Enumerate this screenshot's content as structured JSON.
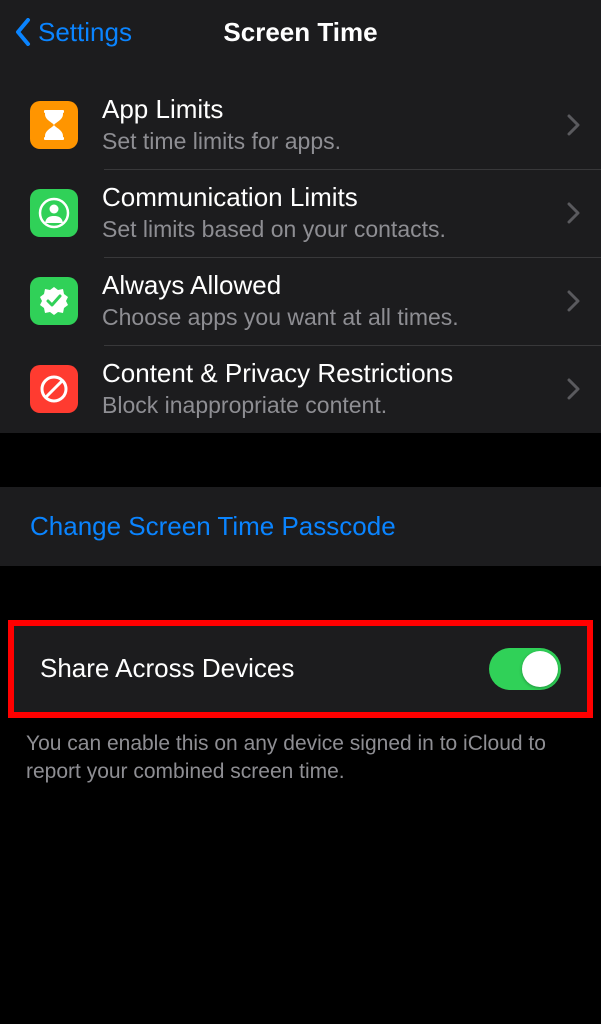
{
  "header": {
    "back_label": "Settings",
    "title": "Screen Time"
  },
  "rows": [
    {
      "title": "App Limits",
      "subtitle": "Set time limits for apps.",
      "icon_name": "hourglass-icon",
      "icon_color": "orange"
    },
    {
      "title": "Communication Limits",
      "subtitle": "Set limits based on your contacts.",
      "icon_name": "contact-circle-icon",
      "icon_color": "green"
    },
    {
      "title": "Always Allowed",
      "subtitle": "Choose apps you want at all times.",
      "icon_name": "check-badge-icon",
      "icon_color": "green"
    },
    {
      "title": "Content & Privacy Restrictions",
      "subtitle": "Block inappropriate content.",
      "icon_name": "no-entry-icon",
      "icon_color": "red"
    }
  ],
  "passcode_link": "Change Screen Time Passcode",
  "share_toggle": {
    "label": "Share Across Devices",
    "enabled": true
  },
  "footer": "You can enable this on any device signed in to iCloud to report your combined screen time."
}
